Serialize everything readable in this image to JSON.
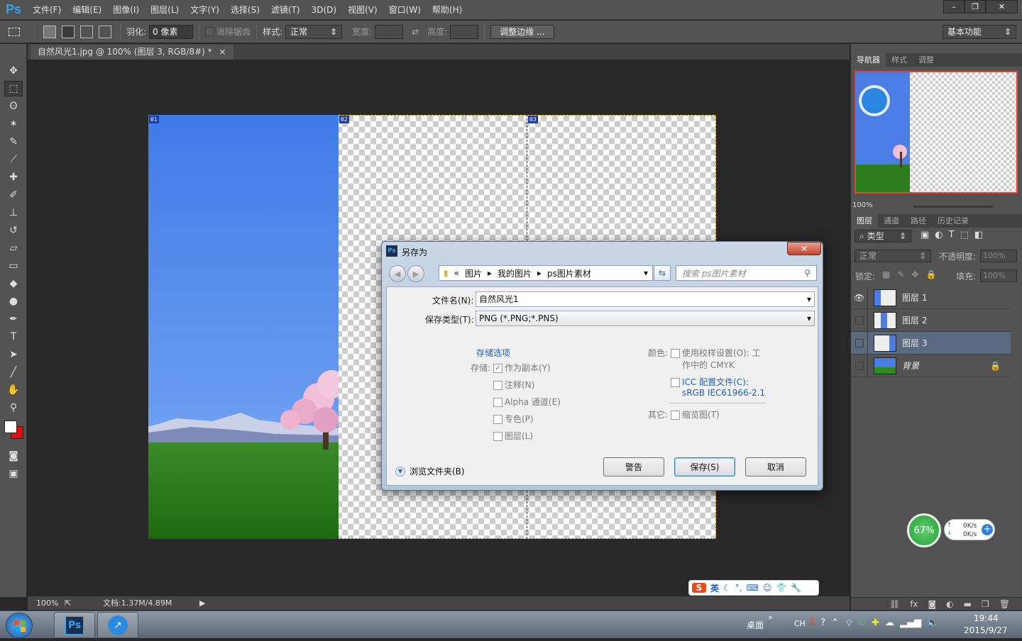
{
  "app": {
    "logo": "Ps",
    "menu": [
      "文件(F)",
      "编辑(E)",
      "图像(I)",
      "图层(L)",
      "文字(Y)",
      "选择(S)",
      "滤镜(T)",
      "3D(D)",
      "视图(V)",
      "窗口(W)",
      "帮助(H)"
    ],
    "window_buttons": [
      "–",
      "❐",
      "✕"
    ]
  },
  "options": {
    "feather_label": "羽化:",
    "feather_value": "0 像素",
    "antialias_label": "消除锯齿",
    "style_label": "样式:",
    "style_value": "正常",
    "width_label": "宽度:",
    "height_label": "高度:",
    "refine_edge_button": "调整边缘 ...",
    "workspace": "基本功能"
  },
  "document": {
    "tab_title": "自然风光1.jpg @ 100% (图层 3, RGB/8#) *",
    "tab_close": "×",
    "slices": [
      "01",
      "02",
      "03"
    ]
  },
  "status": {
    "zoom": "100%",
    "doc_size": "文档:1.37M/4.89M"
  },
  "navigator": {
    "tabs": [
      "导航器",
      "样式",
      "调整"
    ],
    "zoom": "100%"
  },
  "layers_panel": {
    "tabs": [
      "图层",
      "通道",
      "路径",
      "历史记录"
    ],
    "filter_label": "类型",
    "blend_mode": "正常",
    "opacity_label": "不透明度:",
    "opacity_value": "100%",
    "lock_label": "锁定:",
    "fill_label": "填充:",
    "fill_value": "100%",
    "layers": [
      {
        "name": "图层 1",
        "visible": true,
        "selected": false
      },
      {
        "name": "图层 2",
        "visible": false,
        "selected": false
      },
      {
        "name": "图层 3",
        "visible": false,
        "selected": true
      },
      {
        "name": "背景",
        "visible": false,
        "selected": false
      }
    ]
  },
  "dialog": {
    "icon": "Ps",
    "title": "另存为",
    "breadcrumb_prefix": "«",
    "breadcrumb": [
      "图片",
      "我的图片",
      "ps图片素材"
    ],
    "search_placeholder": "搜索 ps图片素材",
    "filename_label": "文件名(N):",
    "filename_value": "自然风光1",
    "filetype_label": "保存类型(T):",
    "filetype_value": "PNG (*.PNG;*.PNS)",
    "save_options_title": "存储选项",
    "storage_label": "存储:",
    "as_copy": "作为副本(Y)",
    "notes": "注释(N)",
    "alpha": "Alpha 通道(E)",
    "spot": "专色(P)",
    "layers": "图层(L)",
    "color_label": "颜色:",
    "proof_setup": "使用校样设置(O): 工",
    "proof_setup_line2": "作中的 CMYK",
    "icc_profile": "ICC 配置文件(C):",
    "icc_value": "sRGB IEC61966-2.1",
    "other_label": "其它:",
    "thumbnail": "缩览图(T)",
    "browse_folders": "浏览文件夹(B)",
    "warning_button": "警告",
    "save_button": "保存(S)",
    "cancel_button": "取消"
  },
  "widget": {
    "percent": "67%",
    "up_speed": "0K/s",
    "down_speed": "0K/s"
  },
  "ime": {
    "mode": "英"
  },
  "taskbar": {
    "desktop_label": "桌面",
    "lang": "CH",
    "time": "19:44",
    "date": "2015/9/27"
  },
  "colors": {
    "ps_blue": "#2fa3f0",
    "selected_layer": "#5b6a80",
    "navigator_border": "#e0443a"
  }
}
